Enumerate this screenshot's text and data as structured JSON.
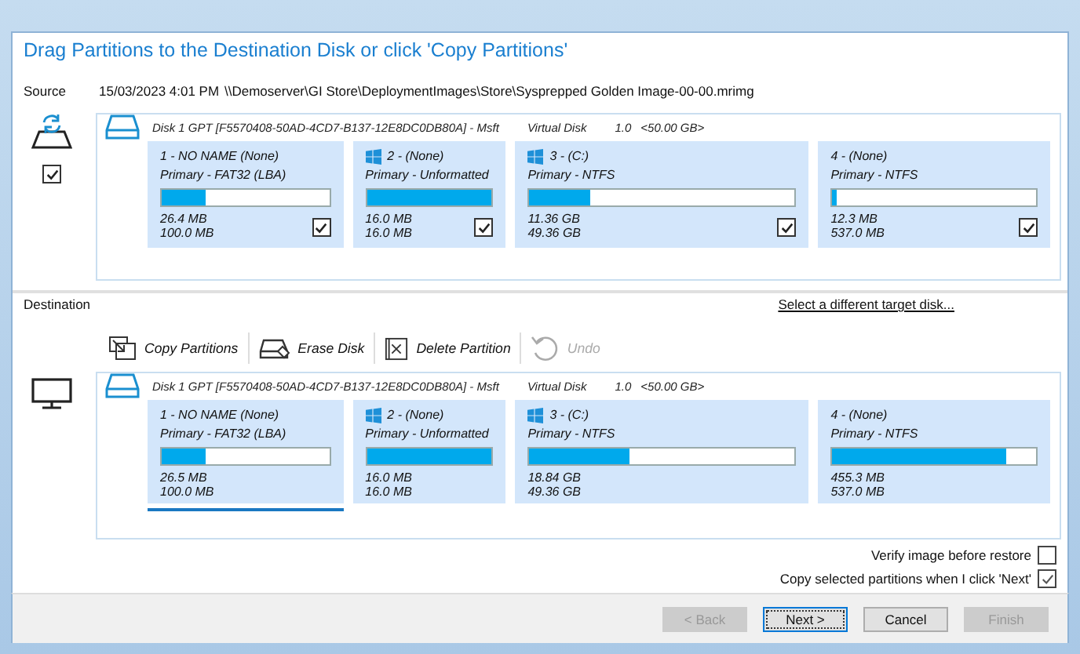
{
  "title": "Drag Partitions to the Destination Disk or click 'Copy Partitions'",
  "source": {
    "label": "Source",
    "date": "15/03/2023 4:01 PM",
    "path": "\\\\Demoserver\\GI Store\\DeploymentImages\\Store\\Sysprepped Golden Image-00-00.mrimg",
    "checked": true,
    "disk": {
      "name": "Disk 1 GPT [F5570408-50AD-4CD7-B137-12E8DC0DB80A] - Msft",
      "type": "Virtual Disk",
      "version": "1.0",
      "size": "<50.00 GB>"
    },
    "partitions": [
      {
        "kind": "plain",
        "title": "1 - NO NAME (None)",
        "type": "Primary - FAT32 (LBA)",
        "level": 0.264,
        "used": "26.4 MB",
        "total": "100.0 MB",
        "checked": true
      },
      {
        "kind": "windows",
        "title": "2 -  (None)",
        "type": "Primary - Unformatted",
        "level": 1,
        "used": "16.0 MB",
        "total": "16.0 MB",
        "checked": true
      },
      {
        "kind": "windows",
        "title": "3 -  (C:)",
        "type": "Primary - NTFS",
        "level": 0.23,
        "used": "11.36 GB",
        "total": "49.36 GB",
        "checked": true
      },
      {
        "kind": "plain",
        "title": "4 -  (None)",
        "type": "Primary - NTFS",
        "level": 0.02,
        "used": "12.3 MB",
        "total": "537.0 MB",
        "checked": true
      }
    ]
  },
  "destination": {
    "label": "Destination",
    "link": "Select a different target disk...",
    "toolbar": [
      {
        "kind": "copy",
        "label": "Copy Partitions",
        "disabled": false
      },
      {
        "kind": "erase",
        "label": "Erase Disk",
        "disabled": false
      },
      {
        "kind": "delete",
        "label": "Delete Partition",
        "disabled": false
      },
      {
        "kind": "undo",
        "label": "Undo",
        "disabled": true
      }
    ],
    "disk": {
      "name": "Disk 1 GPT [F5570408-50AD-4CD7-B137-12E8DC0DB80A] - Msft",
      "type": "Virtual Disk",
      "version": "1.0",
      "size": "<50.00 GB>"
    },
    "partitions": [
      {
        "kind": "plain",
        "title": "1 - NO NAME (None)",
        "type": "Primary - FAT32 (LBA)",
        "level": 0.265,
        "used": "26.5 MB",
        "total": "100.0 MB",
        "selected": true
      },
      {
        "kind": "windows",
        "title": "2 -  (None)",
        "type": "Primary - Unformatted",
        "level": 1,
        "used": "16.0 MB",
        "total": "16.0 MB",
        "selected": false
      },
      {
        "kind": "windows",
        "title": "3 -  (C:)",
        "type": "Primary - NTFS",
        "level": 0.38,
        "used": "18.84 GB",
        "total": "49.36 GB",
        "selected": false
      },
      {
        "kind": "plain",
        "title": "4 -  (None)",
        "type": "Primary - NTFS",
        "level": 0.85,
        "used": "455.3 MB",
        "total": "537.0 MB",
        "selected": false
      }
    ]
  },
  "options": [
    {
      "label": "Verify image before restore",
      "checked": false
    },
    {
      "label": "Copy selected partitions when I click 'Next'",
      "checked": true
    }
  ],
  "buttons": [
    {
      "label": "< Back",
      "disabled": true,
      "default": false
    },
    {
      "label": "Next >",
      "disabled": false,
      "default": true
    },
    {
      "label": "Cancel",
      "disabled": false,
      "default": false
    },
    {
      "label": "Finish",
      "disabled": true,
      "default": false
    }
  ]
}
